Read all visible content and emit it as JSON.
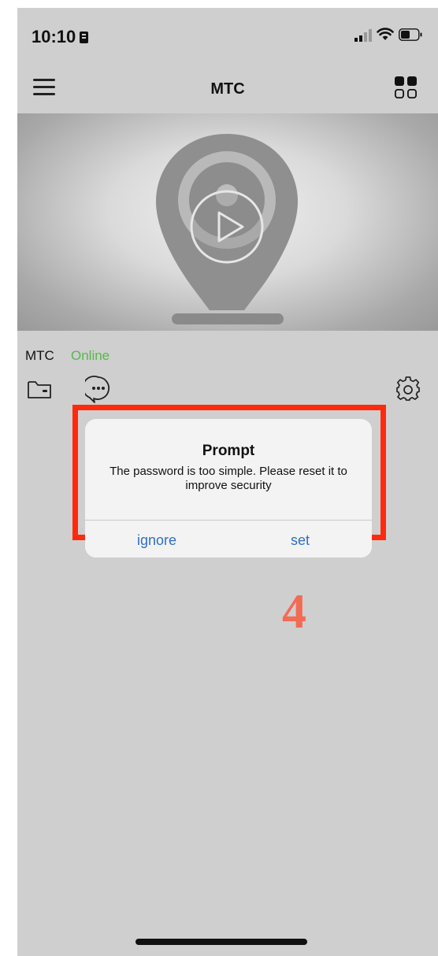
{
  "status_bar": {
    "time": "10:10",
    "icons": [
      "cellular-signal-icon",
      "wifi-icon",
      "battery-icon"
    ]
  },
  "nav": {
    "title": "MTC",
    "left_icon": "hamburger-menu-icon",
    "right_icon": "grid-view-icon"
  },
  "video": {
    "placeholder_icon": "camera-placeholder-icon",
    "play_icon": "play-icon"
  },
  "device": {
    "name": "MTC",
    "status": "Online",
    "status_color": "#55b948",
    "actions": [
      "folder-icon",
      "chat-icon",
      "settings-icon"
    ]
  },
  "dialog": {
    "title": "Prompt",
    "message": "The password is too simple. Please reset it to improve security",
    "ignore_label": "ignore",
    "set_label": "set",
    "button_color": "#2f6fc7"
  },
  "annotation": {
    "step_number": "4",
    "highlight_color": "#ff2a0e"
  }
}
